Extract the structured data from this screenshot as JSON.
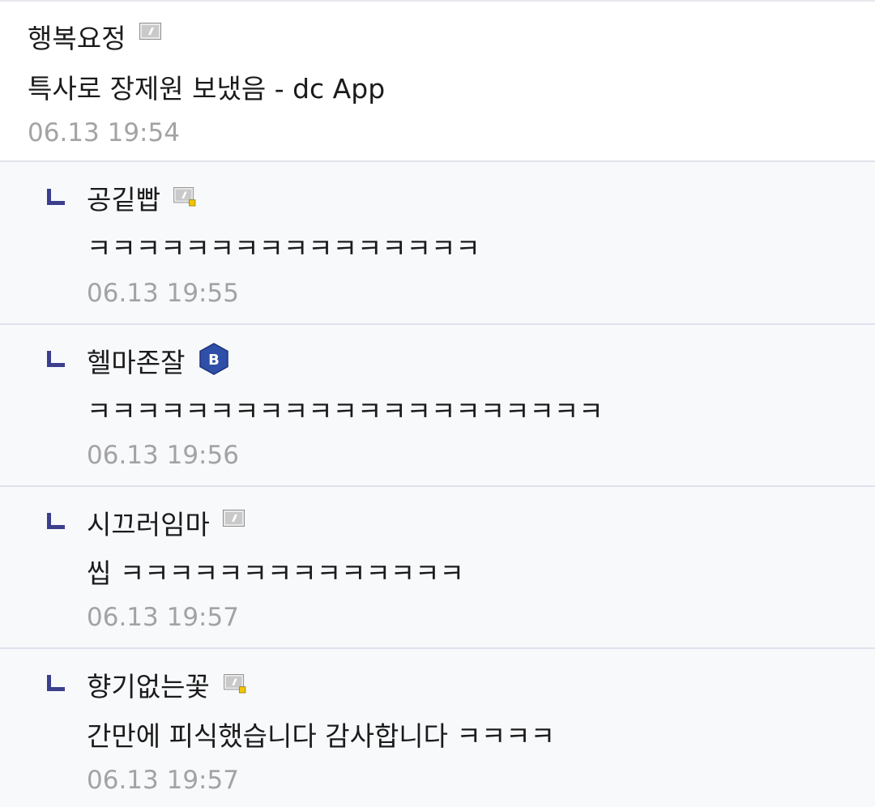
{
  "comments": [
    {
      "nickname": "행복요정",
      "badge": "fixed-nick-gray-icon",
      "text": "특사로 장제원 보냈음 - dc App",
      "date": "06.13 19:54"
    },
    {
      "nickname": "공깉빱",
      "badge": "fixed-nick-gray-yellow-dot-icon",
      "text": "ㅋㅋㅋㅋㅋㅋㅋㅋㅋㅋㅋㅋㅋㅋㅋㅋ",
      "date": "06.13 19:55"
    },
    {
      "nickname": "헬마존잘",
      "badge": "blue-hex-b-icon",
      "badge_letter": "B",
      "text": "ㅋㅋㅋㅋㅋㅋㅋㅋㅋㅋㅋㅋㅋㅋㅋㅋㅋㅋㅋㅋㅋ",
      "date": "06.13 19:56"
    },
    {
      "nickname": "시끄러임마",
      "badge": "fixed-nick-gray-icon",
      "text": "씹 ㅋㅋㅋㅋㅋㅋㅋㅋㅋㅋㅋㅋㅋㅋ",
      "date": "06.13 19:57"
    },
    {
      "nickname": "향기없는꽃",
      "badge": "fixed-nick-gray-yellow-dot-icon",
      "text": "간만에 피식했습니다 감사합니다 ㅋㅋㅋㅋ",
      "date": "06.13 19:57"
    }
  ],
  "colors": {
    "reply_mark": "#3b3f8c",
    "reply_background": "#f8f9fb",
    "divider": "#dfe2ec",
    "date_text": "#a3a3a3",
    "badge_blue": "#2f4fa8",
    "badge_dot_yellow": "#f2c500"
  }
}
